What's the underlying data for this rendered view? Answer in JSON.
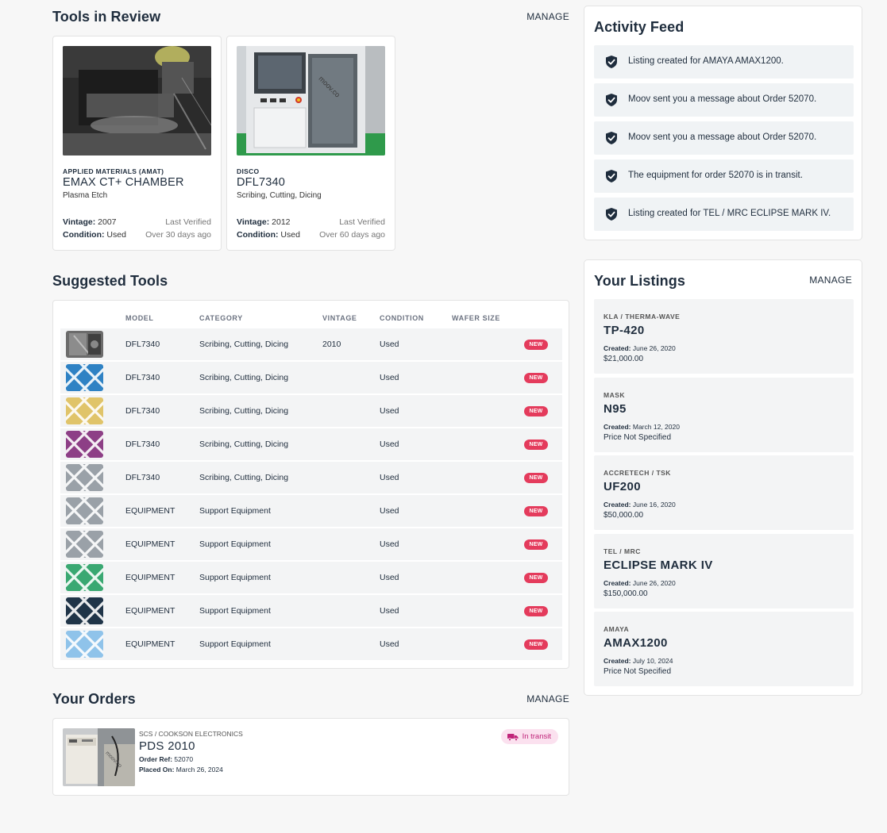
{
  "colors": {
    "page_bg": "#f7f7f7",
    "card_bg": "#ffffff",
    "row_bg": "#f3f4f5",
    "feed_bg": "#f0f3f5",
    "text_dark": "#1f2d3d",
    "new_badge": "#e43b5c",
    "transit_badge_bg": "#fbe1ef",
    "transit_text": "#c0257a"
  },
  "tools_in_review": {
    "title": "Tools in Review",
    "manage": "MANAGE",
    "vintage_label": "Vintage:",
    "condition_label": "Condition:",
    "last_verified_label": "Last Verified",
    "items": [
      {
        "brand": "APPLIED MATERIALS (AMAT)",
        "model": "EMAX CT+ CHAMBER",
        "category": "Plasma Etch",
        "vintage": "2007",
        "condition": "Used",
        "verified": "Over 30 days ago",
        "photo": "machine-chamber-photo"
      },
      {
        "brand": "DISCO",
        "model": "DFL7340",
        "category": "Scribing, Cutting, Dicing",
        "vintage": "2012",
        "condition": "Used",
        "verified": "Over 60 days ago",
        "photo": "dicing-machine-photo"
      }
    ]
  },
  "suggested_tools": {
    "title": "Suggested Tools",
    "columns": [
      "MODEL",
      "CATEGORY",
      "VINTAGE",
      "CONDITION",
      "WAFER SIZE"
    ],
    "badge": "NEW",
    "rows": [
      {
        "model": "DFL7340",
        "category": "Scribing, Cutting, Dicing",
        "vintage": "2010",
        "condition": "Used",
        "wafer": "",
        "thumb": "photo",
        "color": "#6c6c6c"
      },
      {
        "model": "DFL7340",
        "category": "Scribing, Cutting, Dicing",
        "vintage": "",
        "condition": "Used",
        "wafer": "",
        "thumb": "pattern",
        "color": "#2f82c4"
      },
      {
        "model": "DFL7340",
        "category": "Scribing, Cutting, Dicing",
        "vintage": "",
        "condition": "Used",
        "wafer": "",
        "thumb": "pattern",
        "color": "#e0c46a"
      },
      {
        "model": "DFL7340",
        "category": "Scribing, Cutting, Dicing",
        "vintage": "",
        "condition": "Used",
        "wafer": "",
        "thumb": "pattern",
        "color": "#8d3f86"
      },
      {
        "model": "DFL7340",
        "category": "Scribing, Cutting, Dicing",
        "vintage": "",
        "condition": "Used",
        "wafer": "",
        "thumb": "pattern",
        "color": "#9aa1a8"
      },
      {
        "model": "EQUIPMENT",
        "category": "Support Equipment",
        "vintage": "",
        "condition": "Used",
        "wafer": "",
        "thumb": "pattern",
        "color": "#9aa1a8"
      },
      {
        "model": "EQUIPMENT",
        "category": "Support Equipment",
        "vintage": "",
        "condition": "Used",
        "wafer": "",
        "thumb": "pattern",
        "color": "#9aa1a8"
      },
      {
        "model": "EQUIPMENT",
        "category": "Support Equipment",
        "vintage": "",
        "condition": "Used",
        "wafer": "",
        "thumb": "pattern",
        "color": "#3aa872"
      },
      {
        "model": "EQUIPMENT",
        "category": "Support Equipment",
        "vintage": "",
        "condition": "Used",
        "wafer": "",
        "thumb": "pattern",
        "color": "#1f3448"
      },
      {
        "model": "EQUIPMENT",
        "category": "Support Equipment",
        "vintage": "",
        "condition": "Used",
        "wafer": "",
        "thumb": "pattern",
        "color": "#8fc3ea"
      }
    ]
  },
  "orders": {
    "title": "Your Orders",
    "manage": "MANAGE",
    "items": [
      {
        "brand": "SCS / COOKSON ELECTRONICS",
        "model": "PDS 2010",
        "ref_label": "Order Ref:",
        "ref": "52070",
        "placed_label": "Placed On:",
        "placed": "March 26, 2024",
        "status": "In transit",
        "status_icon": "truck-icon"
      }
    ]
  },
  "activity": {
    "title": "Activity Feed",
    "icon": "shield-check-icon",
    "items": [
      "Listing created for AMAYA AMAX1200.",
      "Moov sent you a message about Order 52070.",
      "Moov sent you a message about Order 52070.",
      "The equipment for order 52070 is in transit.",
      "Listing created for TEL / MRC ECLIPSE MARK IV."
    ]
  },
  "listings": {
    "title": "Your Listings",
    "manage": "MANAGE",
    "created_label": "Created:",
    "items": [
      {
        "brand": "KLA / THERMA-WAVE",
        "model": "TP-420",
        "created": "June 26, 2020",
        "price": "$21,000.00"
      },
      {
        "brand": "MASK",
        "model": "N95",
        "created": "March 12, 2020",
        "price": "Price Not Specified"
      },
      {
        "brand": "ACCRETECH / TSK",
        "model": "UF200",
        "created": "June 16, 2020",
        "price": "$50,000.00"
      },
      {
        "brand": "TEL / MRC",
        "model": "ECLIPSE MARK IV",
        "created": "June 26, 2020",
        "price": "$150,000.00"
      },
      {
        "brand": "AMAYA",
        "model": "AMAX1200",
        "created": "July 10, 2024",
        "price": "Price Not Specified"
      }
    ]
  }
}
